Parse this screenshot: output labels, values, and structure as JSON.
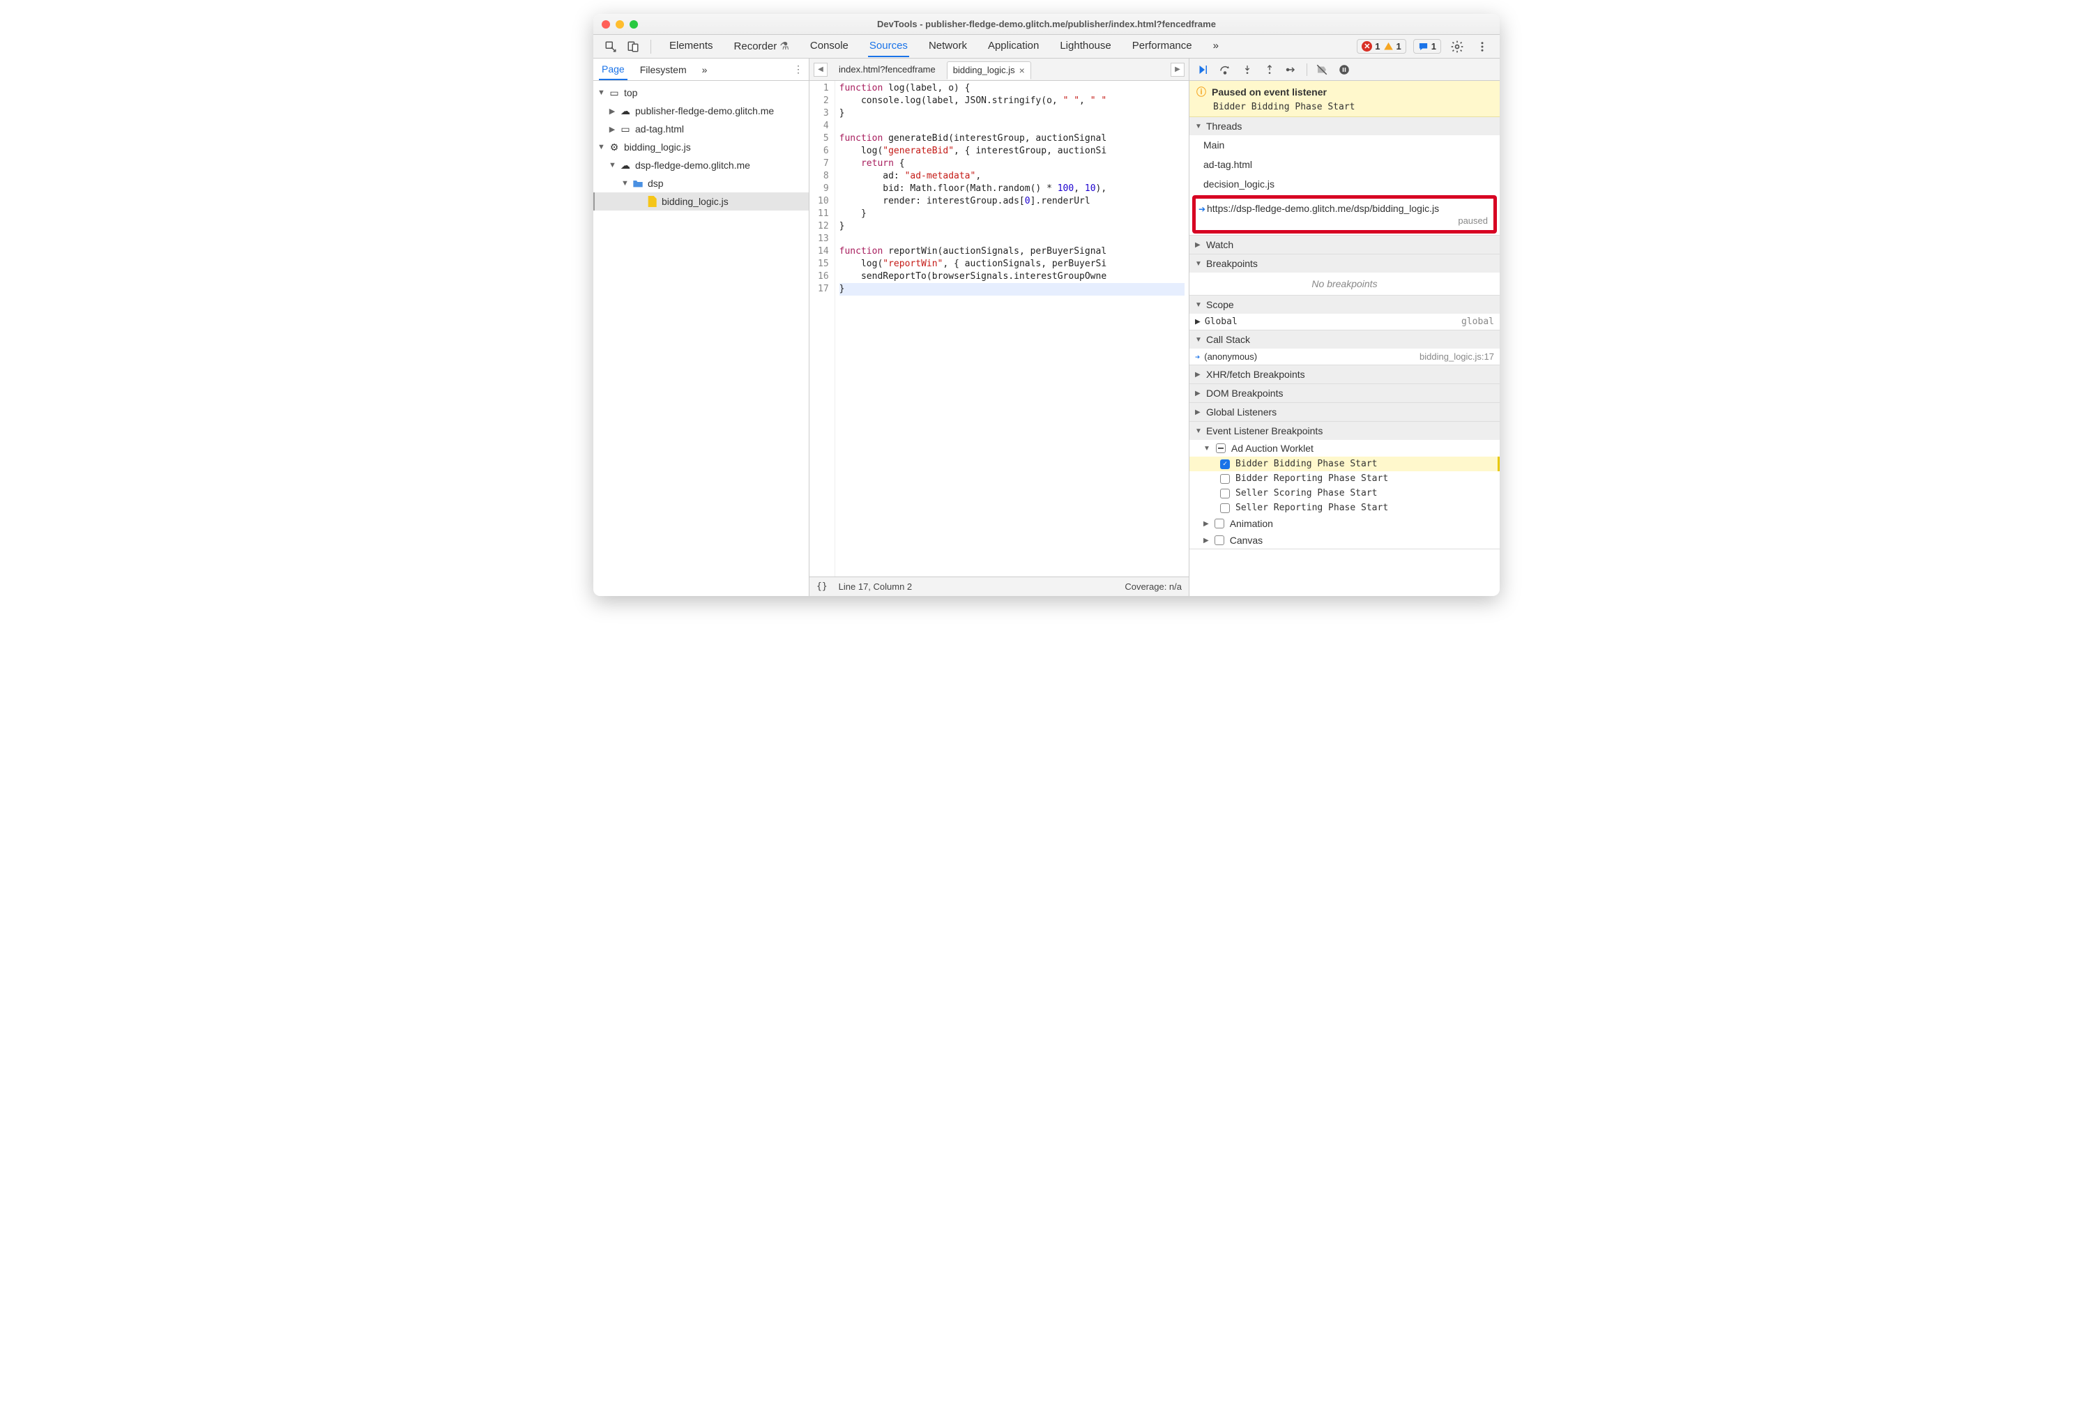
{
  "titlebar": {
    "title": "DevTools - publisher-fledge-demo.glitch.me/publisher/index.html?fencedframe"
  },
  "maintabs": {
    "items": [
      "Elements",
      "Recorder",
      "Console",
      "Sources",
      "Network",
      "Application",
      "Lighthouse",
      "Performance"
    ],
    "active": "Sources",
    "more": "»"
  },
  "topright": {
    "errors": "1",
    "warnings": "1",
    "messages": "1"
  },
  "left": {
    "tabs": [
      "Page",
      "Filesystem"
    ],
    "more": "»",
    "active": "Page",
    "tree": {
      "top": "top",
      "pub": "publisher-fledge-demo.glitch.me",
      "adtag": "ad-tag.html",
      "bidwork": "bidding_logic.js",
      "dsp": "dsp-fledge-demo.glitch.me",
      "dspfolder": "dsp",
      "bidfile": "bidding_logic.js"
    }
  },
  "editor": {
    "tabs": [
      {
        "label": "index.html?fencedframe",
        "active": false
      },
      {
        "label": "bidding_logic.js",
        "active": true
      }
    ],
    "lines": 17,
    "status": {
      "pretty": "{}",
      "pos": "Line 17, Column 2",
      "coverage": "Coverage: n/a"
    }
  },
  "code": {
    "l1a": "function",
    "l1b": " log(label, o) {",
    "l2a": "    console.log(label, JSON.stringify(o, ",
    "l2b": "\" \"",
    "l2c": ", ",
    "l2d": "\" \"",
    "l3": "}",
    "l5a": "function",
    "l5b": " generateBid(interestGroup, auctionSignal",
    "l6a": "    log(",
    "l6b": "\"generateBid\"",
    "l6c": ", { interestGroup, auctionSi",
    "l7a": "    ",
    "l7b": "return",
    "l7c": " {",
    "l8a": "        ad: ",
    "l8b": "\"ad-metadata\"",
    "l8c": ",",
    "l9a": "        bid: Math.floor(Math.random() * ",
    "l9b": "100",
    "l9c": ", ",
    "l9d": "10",
    "l9e": "),",
    "l10": "        render: interestGroup.ads[",
    "l10b": "0",
    "l10c": "].renderUrl",
    "l11": "    }",
    "l12": "}",
    "l14a": "function",
    "l14b": " reportWin(auctionSignals, perBuyerSignal",
    "l15a": "    log(",
    "l15b": "\"reportWin\"",
    "l15c": ", { auctionSignals, perBuyerSi",
    "l16": "    sendReportTo(browserSignals.interestGroupOwne",
    "l17": "}"
  },
  "debugger": {
    "paused": {
      "title": "Paused on event listener",
      "sub": "Bidder Bidding Phase Start"
    },
    "sections": {
      "threads": "Threads",
      "watch": "Watch",
      "breakpoints": "Breakpoints",
      "scope": "Scope",
      "callstack": "Call Stack",
      "xhr": "XHR/fetch Breakpoints",
      "dom": "DOM Breakpoints",
      "global": "Global Listeners",
      "event": "Event Listener Breakpoints"
    },
    "threads": {
      "items": [
        "Main",
        "ad-tag.html",
        "decision_logic.js"
      ],
      "highlight": {
        "url": "https://dsp-fledge-demo.glitch.me/dsp/bidding_logic.js",
        "state": "paused"
      }
    },
    "breakpoints_empty": "No breakpoints",
    "scope": {
      "label": "Global",
      "value": "global"
    },
    "callstack": {
      "frame": "(anonymous)",
      "loc": "bidding_logic.js:17"
    },
    "event_bp": {
      "cat": "Ad Auction Worklet",
      "items": [
        {
          "label": "Bidder Bidding Phase Start",
          "checked": true
        },
        {
          "label": "Bidder Reporting Phase Start",
          "checked": false
        },
        {
          "label": "Seller Scoring Phase Start",
          "checked": false
        },
        {
          "label": "Seller Reporting Phase Start",
          "checked": false
        }
      ],
      "others": [
        "Animation",
        "Canvas"
      ]
    }
  }
}
